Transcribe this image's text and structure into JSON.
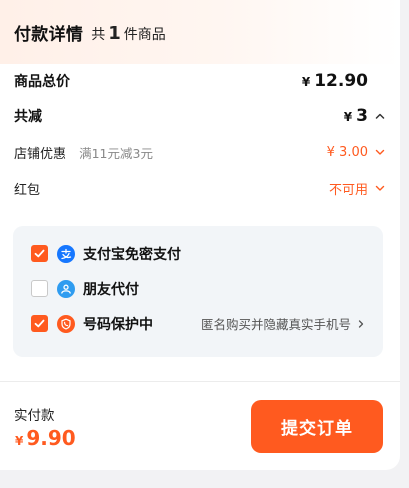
{
  "header": {
    "title": "付款详情",
    "count_prefix": "共",
    "count": "1",
    "count_suffix": "件商品"
  },
  "summary": {
    "total": {
      "label": "商品总价",
      "currency": "¥",
      "amount": "12.90"
    },
    "reduction": {
      "label": "共减",
      "currency": "¥",
      "amount": "3"
    },
    "shop_discount": {
      "label": "店铺优惠",
      "desc": "满11元减3元",
      "value": "¥ 3.00"
    },
    "red_packet": {
      "label": "红包",
      "value": "不可用"
    }
  },
  "options": [
    {
      "label": "支付宝免密支付",
      "checked": true,
      "icon": "alipay-icon",
      "icon_color": "#1677ff"
    },
    {
      "label": "朋友代付",
      "checked": false,
      "icon": "friend-pay-icon",
      "icon_color": "#2f9cf0"
    },
    {
      "label": "号码保护中",
      "checked": true,
      "icon": "phone-shield-icon",
      "icon_color": "#ff5a1f",
      "note": "匿名购买并隐藏真实手机号"
    }
  ],
  "footer": {
    "paid_label": "实付款",
    "currency": "¥",
    "amount": "9.90",
    "submit_label": "提交订单"
  },
  "colors": {
    "accent": "#ff5a1f",
    "panel": "#f2f5f8"
  }
}
